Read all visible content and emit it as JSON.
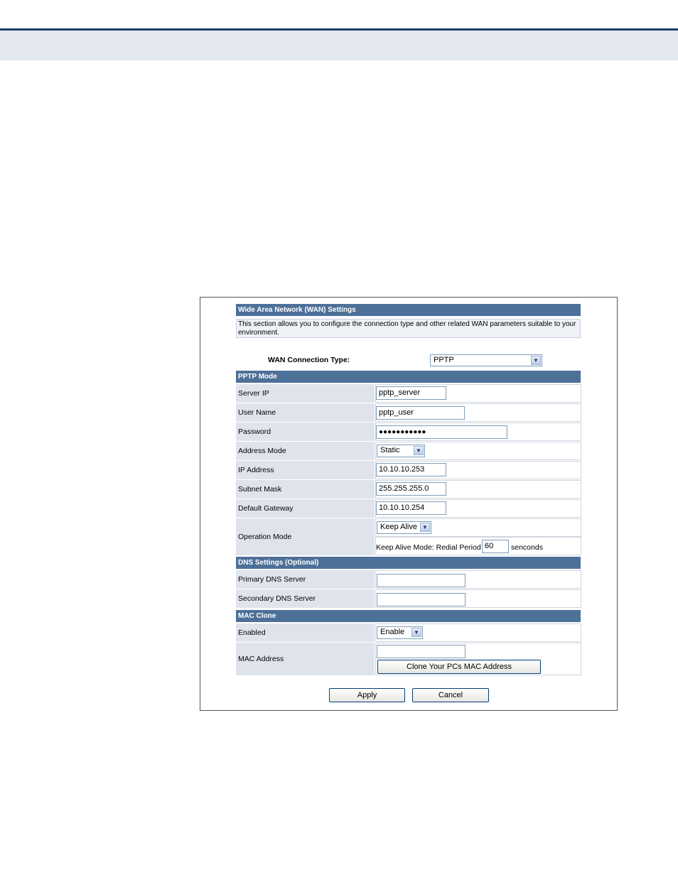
{
  "wan": {
    "header": "Wide Area Network (WAN) Settings",
    "description": "This section allows you to configure the connection type and other related WAN parameters suitable to your environment.",
    "conn_type_label": "WAN Connection Type:",
    "conn_type_value": "PPTP"
  },
  "pptp": {
    "header": "PPTP Mode",
    "server_ip": {
      "label": "Server IP",
      "value": "pptp_server"
    },
    "user_name": {
      "label": "User Name",
      "value": "pptp_user"
    },
    "password": {
      "label": "Password",
      "value": "●●●●●●●●●●●"
    },
    "address_mode": {
      "label": "Address Mode",
      "value": "Static"
    },
    "ip_address": {
      "label": "IP Address",
      "value": "10.10.10.253"
    },
    "subnet_mask": {
      "label": "Subnet Mask",
      "value": "255.255.255.0"
    },
    "default_gateway": {
      "label": "Default Gateway",
      "value": "10.10.10.254"
    },
    "operation_mode": {
      "label": "Operation Mode",
      "value": "Keep Alive",
      "redial_label": "Keep Alive Mode: Redial Period",
      "redial_value": "60",
      "redial_unit": "senconds"
    }
  },
  "dns": {
    "header": "DNS Settings (Optional)",
    "primary": {
      "label": "Primary DNS Server",
      "value": ""
    },
    "secondary": {
      "label": "Secondary DNS Server",
      "value": ""
    }
  },
  "mac": {
    "header": "MAC Clone",
    "enabled": {
      "label": "Enabled",
      "value": "Enable"
    },
    "address": {
      "label": "MAC Address",
      "value": "",
      "clone_button": "Clone Your PCs MAC Address"
    }
  },
  "actions": {
    "apply": "Apply",
    "cancel": "Cancel"
  },
  "icons": {
    "dropdown": "chevron-down-icon"
  }
}
